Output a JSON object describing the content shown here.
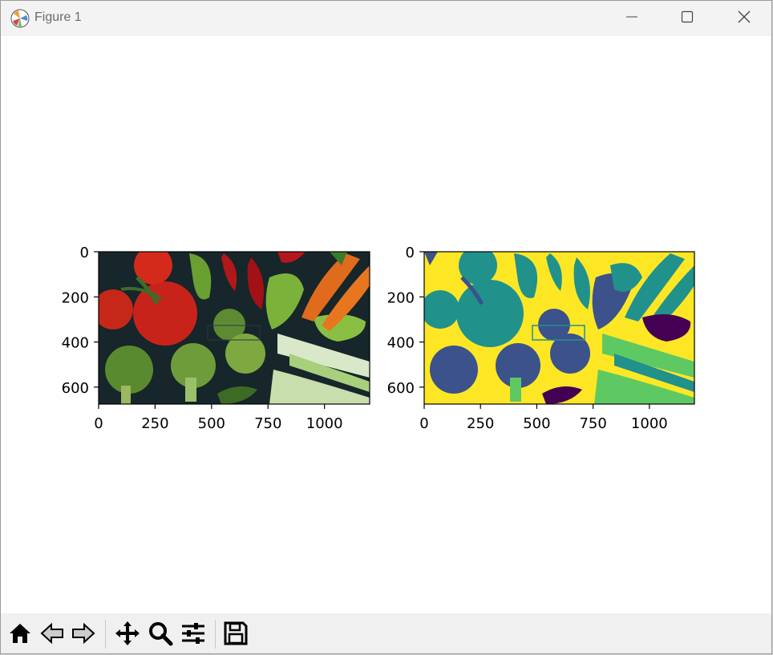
{
  "window": {
    "title": "Figure 1"
  },
  "icons": {
    "app": "matplotlib-icon",
    "minimize": "minimize-icon",
    "maximize": "maximize-icon",
    "close": "close-icon"
  },
  "axes": [
    {
      "name": "original-image",
      "x_ticks": [
        "0",
        "250",
        "500",
        "750",
        "1000"
      ],
      "y_ticks": [
        "0",
        "200",
        "400",
        "600"
      ]
    },
    {
      "name": "segmented-image",
      "x_ticks": [
        "0",
        "250",
        "500",
        "750",
        "1000"
      ],
      "y_ticks": [
        "0",
        "200",
        "400",
        "600"
      ]
    }
  ],
  "toolbar": [
    {
      "name": "home-icon",
      "tooltip": "Home"
    },
    {
      "name": "back-icon",
      "tooltip": "Back"
    },
    {
      "name": "forward-icon",
      "tooltip": "Forward"
    },
    {
      "name": "pan-icon",
      "tooltip": "Pan"
    },
    {
      "name": "zoom-icon",
      "tooltip": "Zoom"
    },
    {
      "name": "subplots-icon",
      "tooltip": "Configure subplots"
    },
    {
      "name": "save-icon",
      "tooltip": "Save"
    }
  ],
  "colors": {
    "viridis_yellow": "#fde725",
    "viridis_teal": "#21918c",
    "viridis_purple": "#3b528b",
    "viridis_dark": "#440154",
    "viridis_green": "#5ec962"
  }
}
